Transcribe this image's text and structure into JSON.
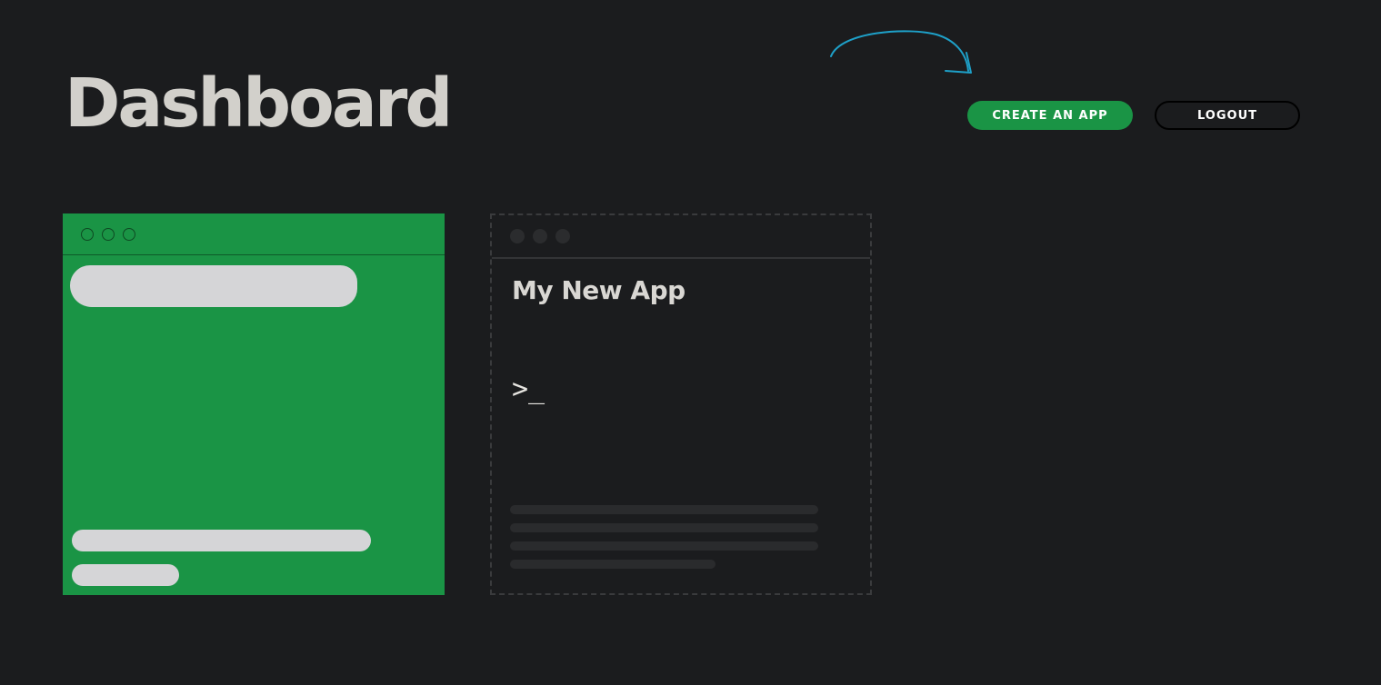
{
  "header": {
    "title": "Dashboard",
    "create_app_label": "CREATE AN APP",
    "logout_label": "LOGOUT"
  },
  "apps": [
    {
      "name": "",
      "accent_color": "#1a9445",
      "redacted": true
    }
  ],
  "new_app_card": {
    "title": "My New App",
    "terminal_glyph": ">_"
  },
  "colors": {
    "background": "#1b1c1e",
    "accent": "#1a9445",
    "annotation": "#1ea0c8"
  }
}
